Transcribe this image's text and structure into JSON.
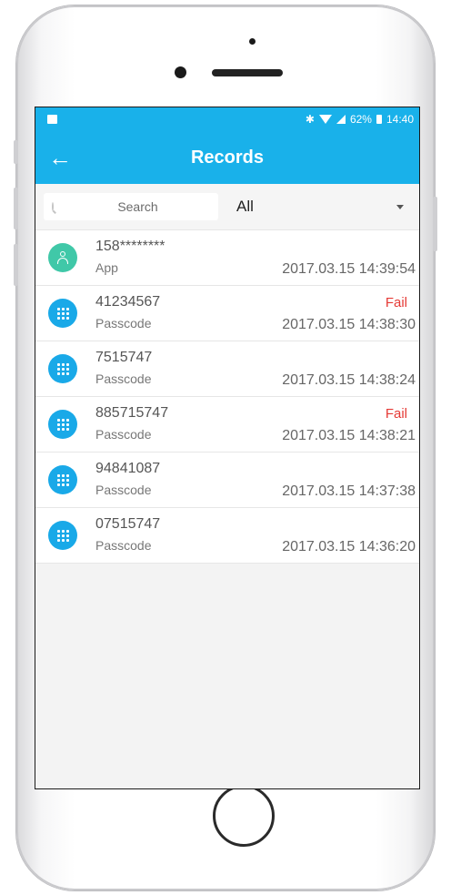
{
  "statusbar": {
    "battery": "62%",
    "time": "14:40"
  },
  "header": {
    "title": "Records",
    "back_icon": "arrow-left-icon"
  },
  "filter": {
    "search_placeholder": "Search",
    "selected": "All"
  },
  "records": [
    {
      "id": "158********",
      "type": "App",
      "icon": "person-icon",
      "status": "",
      "time": "2017.03.15 14:39:54"
    },
    {
      "id": "41234567",
      "type": "Passcode",
      "icon": "keypad-icon",
      "status": "Fail",
      "time": "2017.03.15 14:38:30"
    },
    {
      "id": "7515747",
      "type": "Passcode",
      "icon": "keypad-icon",
      "status": "",
      "time": "2017.03.15 14:38:24"
    },
    {
      "id": "885715747",
      "type": "Passcode",
      "icon": "keypad-icon",
      "status": "Fail",
      "time": "2017.03.15 14:38:21"
    },
    {
      "id": "94841087",
      "type": "Passcode",
      "icon": "keypad-icon",
      "status": "",
      "time": "2017.03.15 14:37:38"
    },
    {
      "id": "07515747",
      "type": "Passcode",
      "icon": "keypad-icon",
      "status": "",
      "time": "2017.03.15 14:36:20"
    }
  ],
  "colors": {
    "primary": "#19b1ea",
    "fail": "#e53935",
    "app_icon": "#40c8a8",
    "passcode_icon": "#19a9e8"
  }
}
